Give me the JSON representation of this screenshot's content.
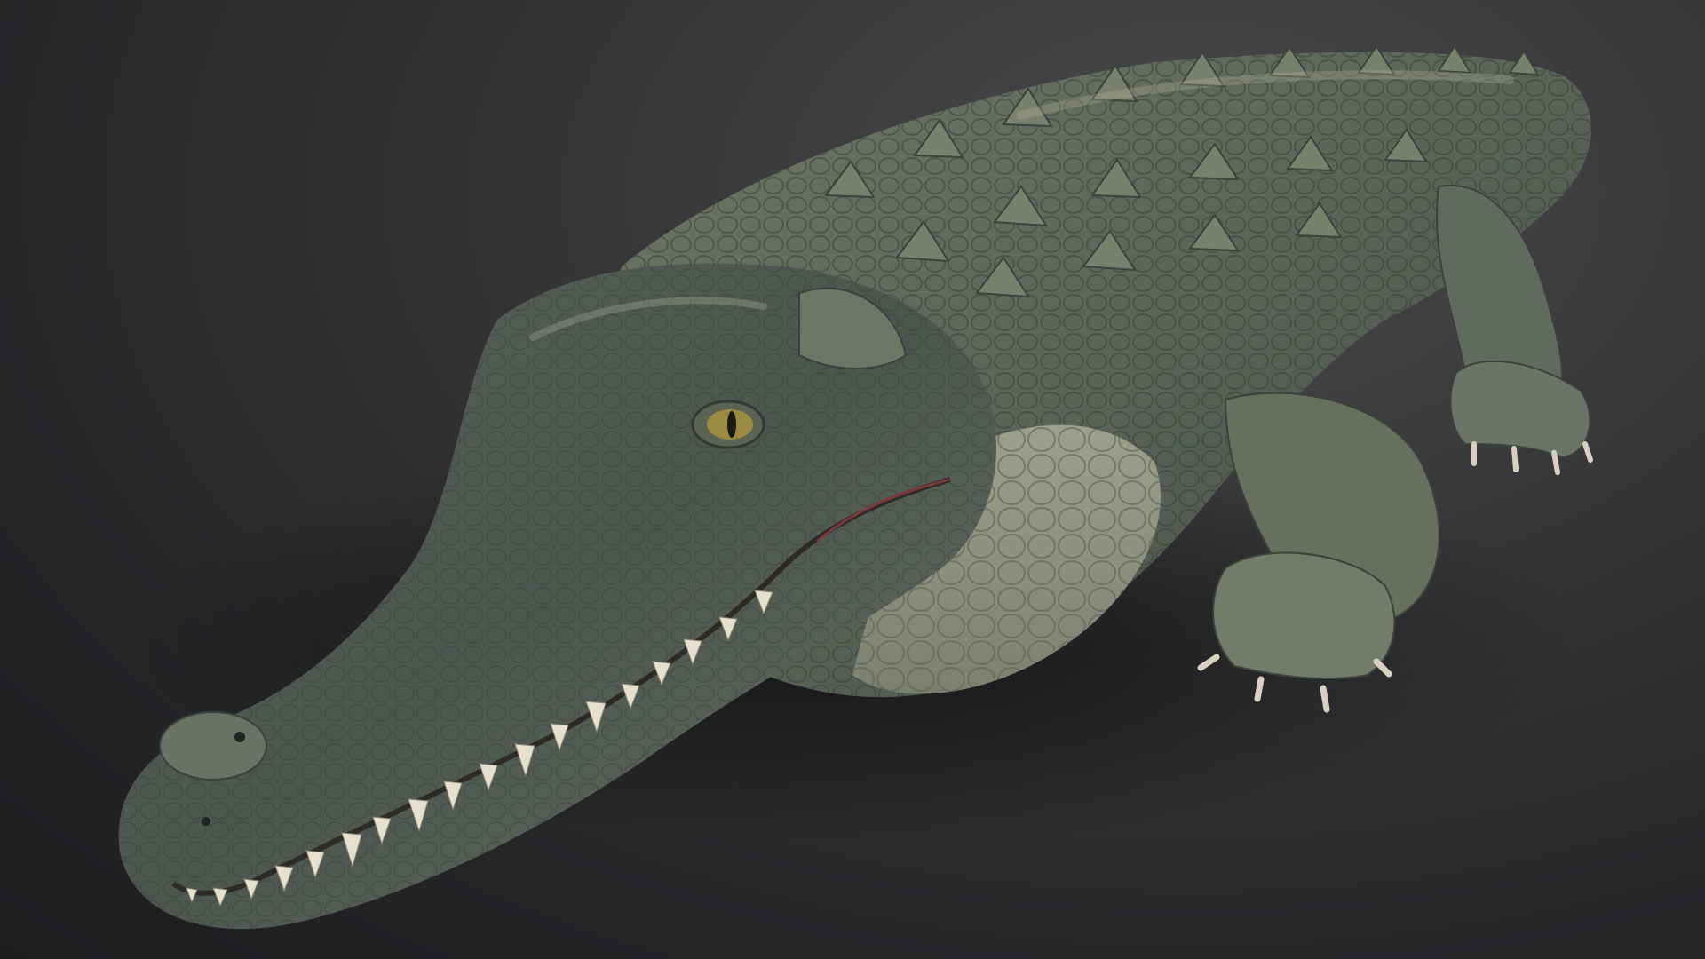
{
  "scene": {
    "subject": "crocodile-3d-render",
    "colors": {
      "backdrop_light": "#4a4a4c",
      "backdrop_dark": "#1d1d20",
      "skin_dark": "#3f4a44",
      "skin_mid": "#5f6b60",
      "skin_light": "#8f9583",
      "belly": "#a8a898",
      "teeth": "#e6e0d0",
      "eye": "#9a8a42",
      "claw": "#d8d0c2"
    }
  }
}
